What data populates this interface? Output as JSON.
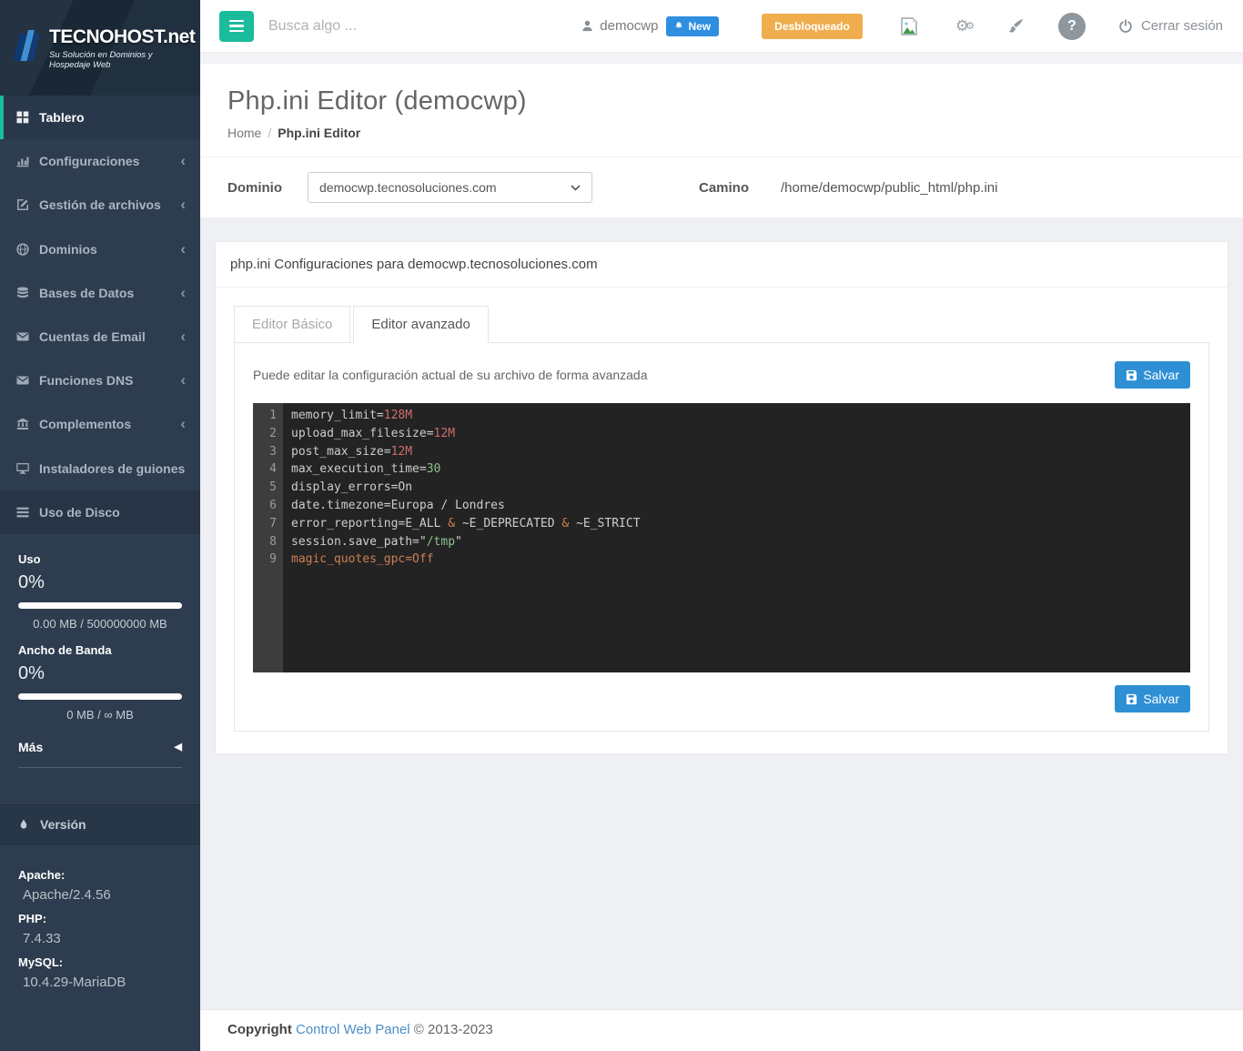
{
  "sidebar": {
    "logo": {
      "brand": "TECNOHOST",
      "brand_suffix": ".net",
      "tagline": "Su Solución en Dominios y Hospedaje Web"
    },
    "menu": [
      {
        "label": "Tablero",
        "icon": "dashboard-icon",
        "active": true
      },
      {
        "label": "Configuraciones",
        "icon": "bar-chart-icon",
        "chevron": "‹"
      },
      {
        "label": "Gestión de archivos",
        "icon": "edit-icon",
        "chevron": "‹"
      },
      {
        "label": "Dominios",
        "icon": "globe-icon",
        "chevron": "‹"
      },
      {
        "label": "Bases de Datos",
        "icon": "database-icon",
        "chevron": "‹"
      },
      {
        "label": "Cuentas de Email",
        "icon": "envelope-icon",
        "chevron": "‹"
      },
      {
        "label": "Funciones DNS",
        "icon": "envelope-icon",
        "chevron": "‹"
      },
      {
        "label": "Complementos",
        "icon": "bank-icon",
        "chevron": "‹"
      },
      {
        "label": "Instaladores de guiones",
        "icon": "desktop-icon"
      },
      {
        "label": "Uso de Disco",
        "icon": "list-icon",
        "highlight": true
      }
    ],
    "usage": {
      "disk_label": "Uso",
      "disk_percent": "0%",
      "disk_detail": "0.00 MB / 500000000 MB",
      "bw_label": "Ancho de Banda",
      "bw_percent": "0%",
      "bw_detail": "0 MB / ∞ MB",
      "more_label": "Más",
      "more_arrow": "◀"
    },
    "version": {
      "header": "Versión",
      "items": [
        {
          "label": "Apache:",
          "value": "Apache/2.4.56"
        },
        {
          "label": "PHP:",
          "value": "7.4.33"
        },
        {
          "label": "MySQL:",
          "value": "10.4.29-MariaDB"
        }
      ]
    }
  },
  "topbar": {
    "search_placeholder": "Busca algo ...",
    "username": "democwp",
    "new_badge": "New",
    "unlocked_button": "Desbloqueado",
    "help_label": "?",
    "logout_label": "Cerrar sesión"
  },
  "page": {
    "title": "Php.ini Editor (democwp)",
    "breadcrumb": {
      "home": "Home",
      "separator": "/",
      "current": "Php.ini Editor"
    }
  },
  "domain_bar": {
    "domain_label": "Dominio",
    "domain_value": "democwp.tecnosoluciones.com",
    "path_label": "Camino",
    "path_value": "/home/democwp/public_html/php.ini"
  },
  "panel": {
    "heading": "php.ini Configuraciones para democwp.tecnosoluciones.com",
    "tabs": [
      {
        "label": "Editor Básico",
        "active": false
      },
      {
        "label": "Editor avanzado",
        "active": true
      }
    ],
    "description": "Puede editar la configuración actual de su archivo de forma avanzada",
    "save_label": "Salvar",
    "editor": {
      "lines": [
        {
          "n": "1",
          "seg": [
            {
              "t": "memory_limit=",
              "c": "d"
            },
            {
              "t": "128M",
              "c": "r"
            }
          ]
        },
        {
          "n": "2",
          "seg": [
            {
              "t": "upload_max_filesize=",
              "c": "d"
            },
            {
              "t": "12M",
              "c": "r"
            }
          ]
        },
        {
          "n": "3",
          "seg": [
            {
              "t": "post_max_size=",
              "c": "d"
            },
            {
              "t": "12M",
              "c": "r"
            }
          ]
        },
        {
          "n": "4",
          "seg": [
            {
              "t": "max_execution_time=",
              "c": "d"
            },
            {
              "t": "30",
              "c": "g"
            }
          ]
        },
        {
          "n": "5",
          "seg": [
            {
              "t": "display_errors=On",
              "c": "d"
            }
          ]
        },
        {
          "n": "6",
          "seg": [
            {
              "t": "date.timezone=Europa / Londres",
              "c": "d"
            }
          ]
        },
        {
          "n": "7",
          "seg": [
            {
              "t": "error_reporting=E_ALL ",
              "c": "d"
            },
            {
              "t": "&",
              "c": "o"
            },
            {
              "t": " ~E_DEPRECATED ",
              "c": "d"
            },
            {
              "t": "&",
              "c": "o"
            },
            {
              "t": " ~E_STRICT",
              "c": "d"
            }
          ]
        },
        {
          "n": "8",
          "seg": [
            {
              "t": "session.save_path=\"",
              "c": "d"
            },
            {
              "t": "/tmp",
              "c": "g"
            },
            {
              "t": "\"",
              "c": "d"
            }
          ]
        },
        {
          "n": "9",
          "seg": [
            {
              "t": "magic_quotes_gpc=Off",
              "c": "o"
            }
          ]
        }
      ]
    }
  },
  "footer": {
    "copyright_label": "Copyright",
    "link": "Control Web Panel",
    "years": "© 2013-2023"
  },
  "colors": {
    "accent_green": "#1abc9c",
    "badge_blue": "#2f8ee0",
    "warning_orange": "#f0ad4e",
    "save_blue": "#2e8fd5",
    "sidebar_bg": "#2d3c4e",
    "editor_bg": "#232323",
    "code_default": "#cdcdcd",
    "code_red": "#cc6e6e",
    "code_green": "#8ec08e",
    "code_orange": "#cd7e54"
  }
}
